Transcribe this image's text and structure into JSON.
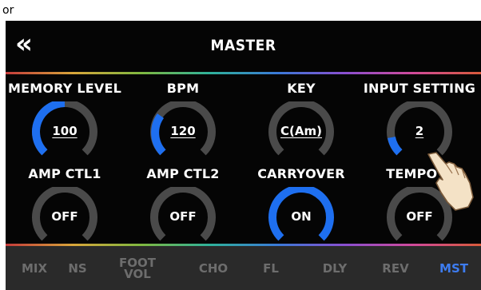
{
  "caption": "or",
  "header": {
    "back_icon": "double-chevron-left",
    "title": "MASTER"
  },
  "colors": {
    "accent": "#1e6ff0",
    "track": "#4a4a4a",
    "nav_active": "#3d7cf0",
    "nav_inactive": "#6d6d6d"
  },
  "params": [
    {
      "label": "MEMORY LEVEL",
      "value": "100",
      "level": 0.5
    },
    {
      "label": "BPM",
      "value": "120",
      "level": 0.3
    },
    {
      "label": "KEY",
      "value": "C(Am)",
      "level": 0
    },
    {
      "label": "INPUT SETTING",
      "value": "2",
      "level": 0.1
    },
    {
      "label": "AMP CTL1",
      "value": "OFF",
      "level": 0
    },
    {
      "label": "AMP CTL2",
      "value": "OFF",
      "level": 0
    },
    {
      "label": "CARRYOVER",
      "value": "ON",
      "level": 1
    },
    {
      "label": "TEMPO H",
      "value": "OFF",
      "level": 0
    }
  ],
  "nav": {
    "mix": "MIX",
    "ns": "NS",
    "foot_vol_line1": "FOOT",
    "foot_vol_line2": "VOL",
    "cho": "CHO",
    "fl": "FL",
    "dly": "DLY",
    "rev": "REV",
    "mst": "MST",
    "active": "MST"
  }
}
